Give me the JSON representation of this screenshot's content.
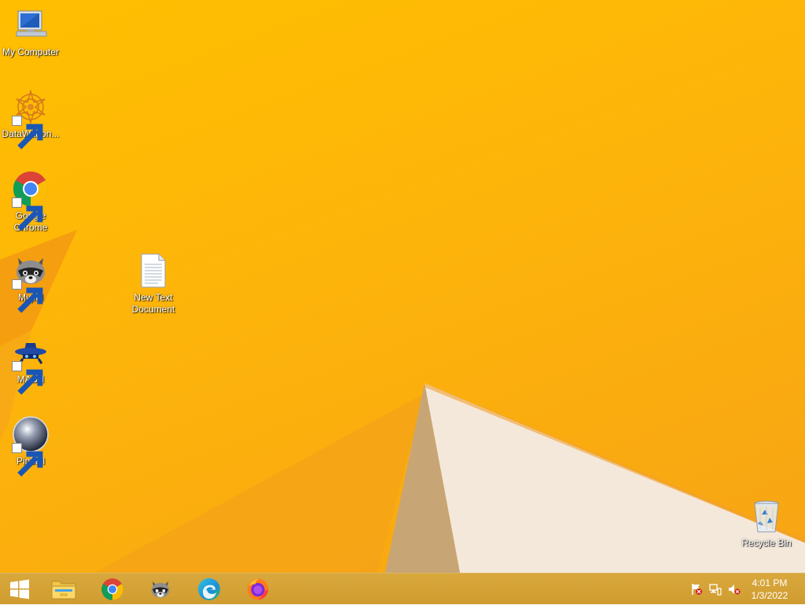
{
  "desktop": {
    "icons": [
      {
        "label": "My Computer",
        "icon": "my-computer-icon"
      },
      {
        "label": "DataWagon...",
        "icon": "datawagon-icon"
      },
      {
        "label": "Google Chrome",
        "icon": "chrome-icon"
      },
      {
        "label": "Mypal",
        "icon": "mypal-icon"
      },
      {
        "label": "MASH",
        "icon": "mash-icon"
      },
      {
        "label": "Pinball",
        "icon": "pinball-icon"
      },
      {
        "label": "New Text Document",
        "icon": "text-document-icon"
      },
      {
        "label": "Recycle Bin",
        "icon": "recycle-bin-icon"
      }
    ],
    "wallpaper_colors": {
      "base": "#fdb40a",
      "light_shape": "#f3e6d8",
      "shadow": "#c9a070"
    }
  },
  "taskbar": {
    "start": {
      "icon": "windows-start-icon"
    },
    "pinned": [
      {
        "name": "File Explorer",
        "icon": "file-explorer-icon"
      },
      {
        "name": "Google Chrome",
        "icon": "chrome-icon"
      },
      {
        "name": "Mypal",
        "icon": "mypal-icon"
      },
      {
        "name": "Microsoft Edge",
        "icon": "edge-icon"
      },
      {
        "name": "Firefox",
        "icon": "firefox-icon"
      }
    ],
    "tray": {
      "icons": [
        "action-center-flag-icon",
        "network-icon",
        "volume-muted-icon"
      ],
      "time": "4:01 PM",
      "date": "1/3/2022"
    }
  }
}
